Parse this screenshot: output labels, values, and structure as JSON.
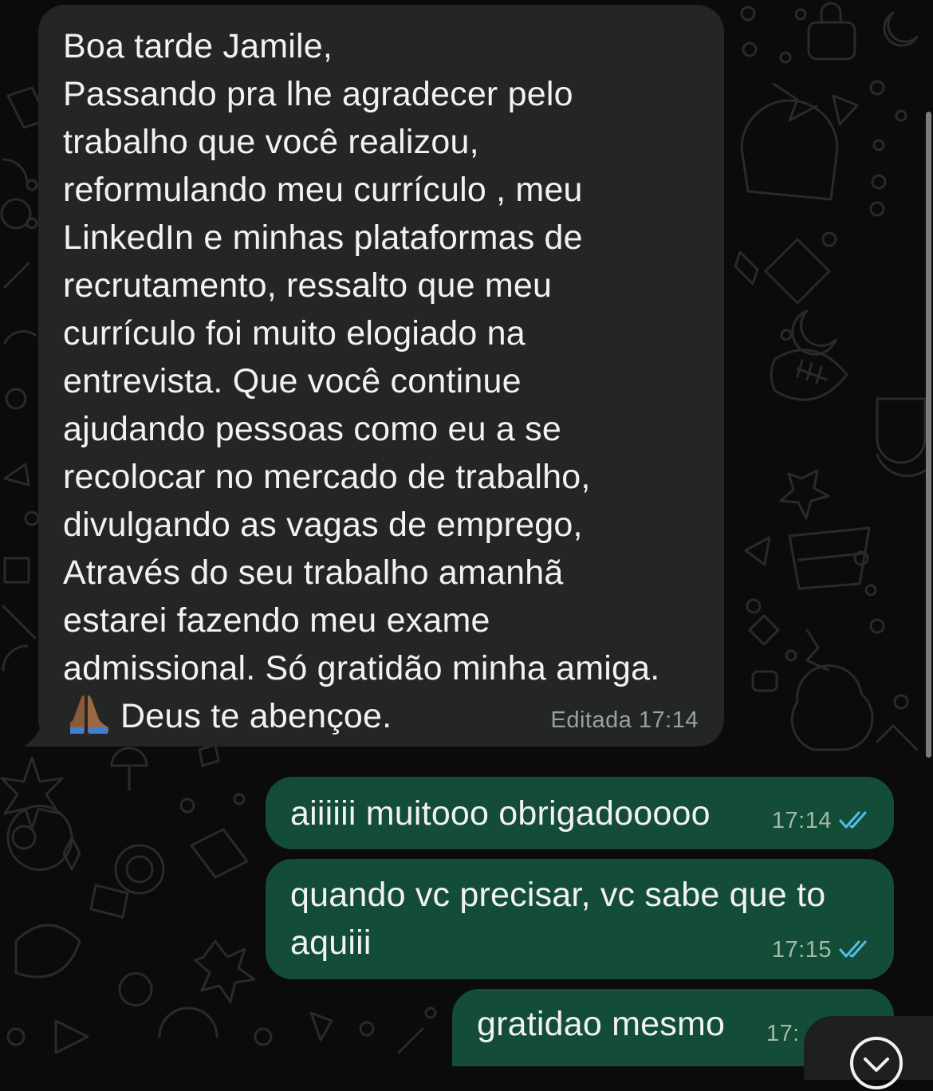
{
  "conversation": {
    "messages": [
      {
        "direction": "incoming",
        "text": "Boa tarde Jamile,\nPassando pra lhe agradecer pelo\ntrabalho que você realizou,\nreformulando meu currículo , meu\nLinkedIn e minhas plataformas de\nrecrutamento, ressalto que meu\ncurrículo foi muito elogiado na\nentrevista. Que você continue\najudando pessoas como eu a se\nrecolocar no mercado de trabalho,\ndivulgando as vagas de emprego,\nAtravés do seu trabalho amanhã\nestarei fazendo meu exame\nadmissional. Só gratidão minha amiga.",
        "last_line": "Deus te abençoe.",
        "emoji_icon": "praying-hands-icon",
        "edited_label": "Editada",
        "time": "17:14"
      },
      {
        "direction": "outgoing",
        "text": "aiiiiii muitooo obrigadooooo",
        "time": "17:14",
        "status_icon": "double-check-read-icon"
      },
      {
        "direction": "outgoing",
        "text": "quando vc precisar, vc sabe que to aquiii",
        "time": "17:15",
        "status_icon": "double-check-read-icon"
      },
      {
        "direction": "outgoing",
        "text": "gratidao mesmo",
        "time": "17:",
        "status_icon": ""
      }
    ]
  },
  "controls": {
    "scroll_down_icon": "chevron-down-circle-icon"
  },
  "colors": {
    "background": "#0b0b0b",
    "incoming_bubble": "#242626",
    "outgoing_bubble": "#134d37",
    "text": "#f2f2f2",
    "meta_text": "#9aa0a0",
    "read_ticks": "#53bdeb"
  }
}
